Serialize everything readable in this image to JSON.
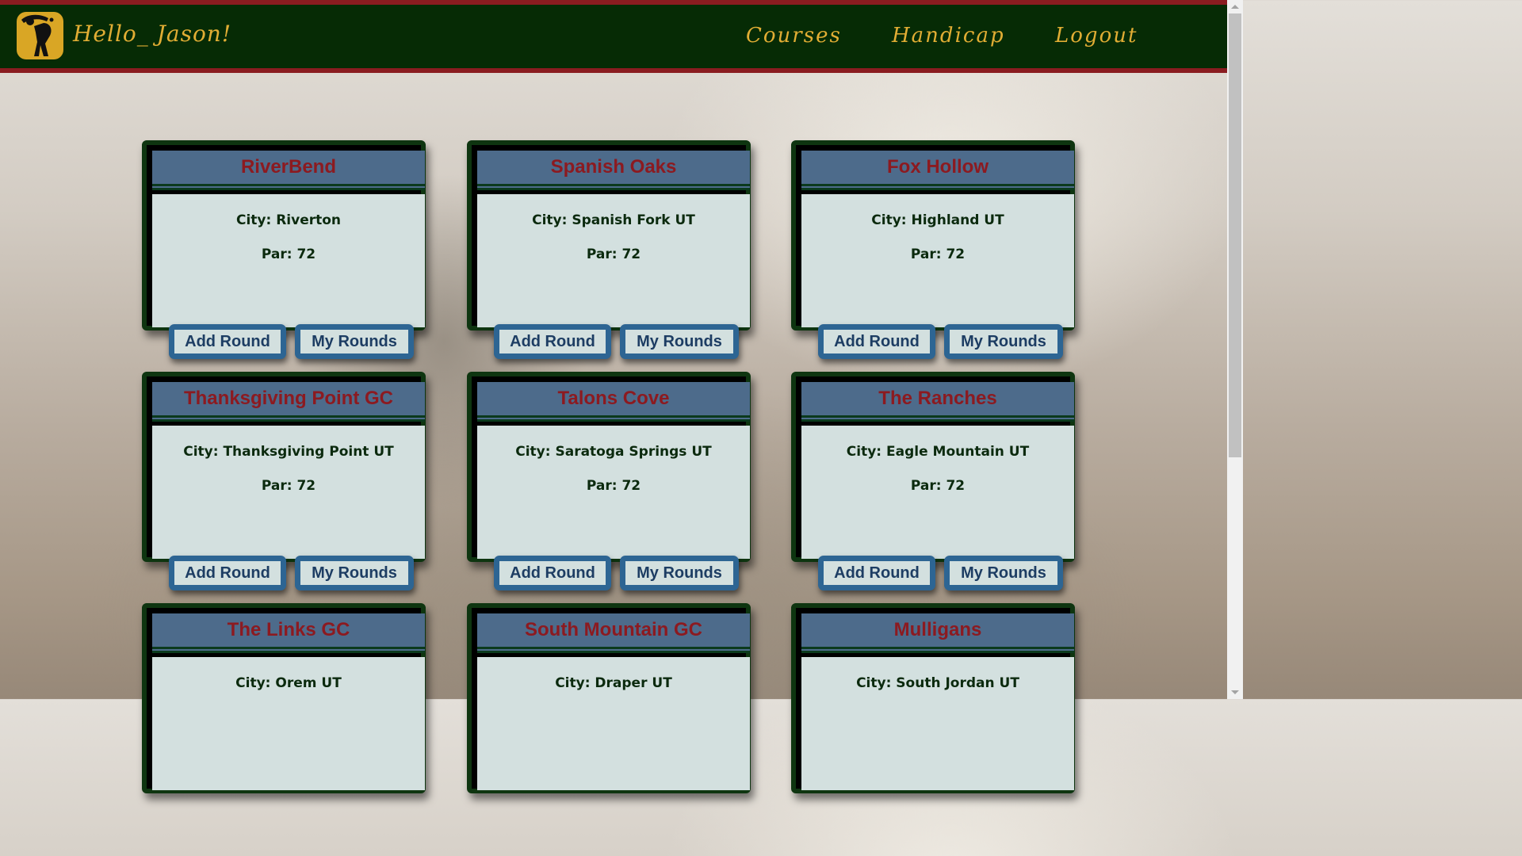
{
  "nav": {
    "greeting": "Hello_ Jason!",
    "links": [
      "Courses",
      "Handicap",
      "Logout"
    ]
  },
  "colors": {
    "navbar": "#062b05",
    "accent_stripe": "#8a1c20",
    "nav_text": "#e1ad34",
    "card_header": "#4d6b8b",
    "card_title": "#8c1a20",
    "card_body": "#d3e0df",
    "button_border": "#2d6593"
  },
  "icons": {
    "logo": "golfer-icon"
  },
  "courses": [
    {
      "name": "RiverBend",
      "city": "City: Riverton",
      "par": "Par: 72",
      "add_label": "Add Round",
      "my_label": "My Rounds"
    },
    {
      "name": "Spanish Oaks",
      "city": "City: Spanish Fork UT",
      "par": "Par: 72",
      "add_label": "Add Round",
      "my_label": "My Rounds"
    },
    {
      "name": "Fox Hollow",
      "city": "City: Highland UT",
      "par": "Par: 72",
      "add_label": "Add Round",
      "my_label": "My Rounds"
    },
    {
      "name": "Thanksgiving Point GC",
      "city": "City: Thanksgiving Point UT",
      "par": "Par: 72",
      "add_label": "Add Round",
      "my_label": "My Rounds"
    },
    {
      "name": "Talons Cove",
      "city": "City: Saratoga Springs UT",
      "par": "Par: 72",
      "add_label": "Add Round",
      "my_label": "My Rounds"
    },
    {
      "name": "The Ranches",
      "city": "City: Eagle Mountain UT",
      "par": "Par: 72",
      "add_label": "Add Round",
      "my_label": "My Rounds"
    },
    {
      "name": "The Links GC",
      "city": "City: Orem UT",
      "par": "",
      "add_label": "",
      "my_label": ""
    },
    {
      "name": "South Mountain GC",
      "city": "City: Draper UT",
      "par": "",
      "add_label": "",
      "my_label": ""
    },
    {
      "name": "Mulligans",
      "city": "City: South Jordan UT",
      "par": "",
      "add_label": "",
      "my_label": ""
    }
  ]
}
